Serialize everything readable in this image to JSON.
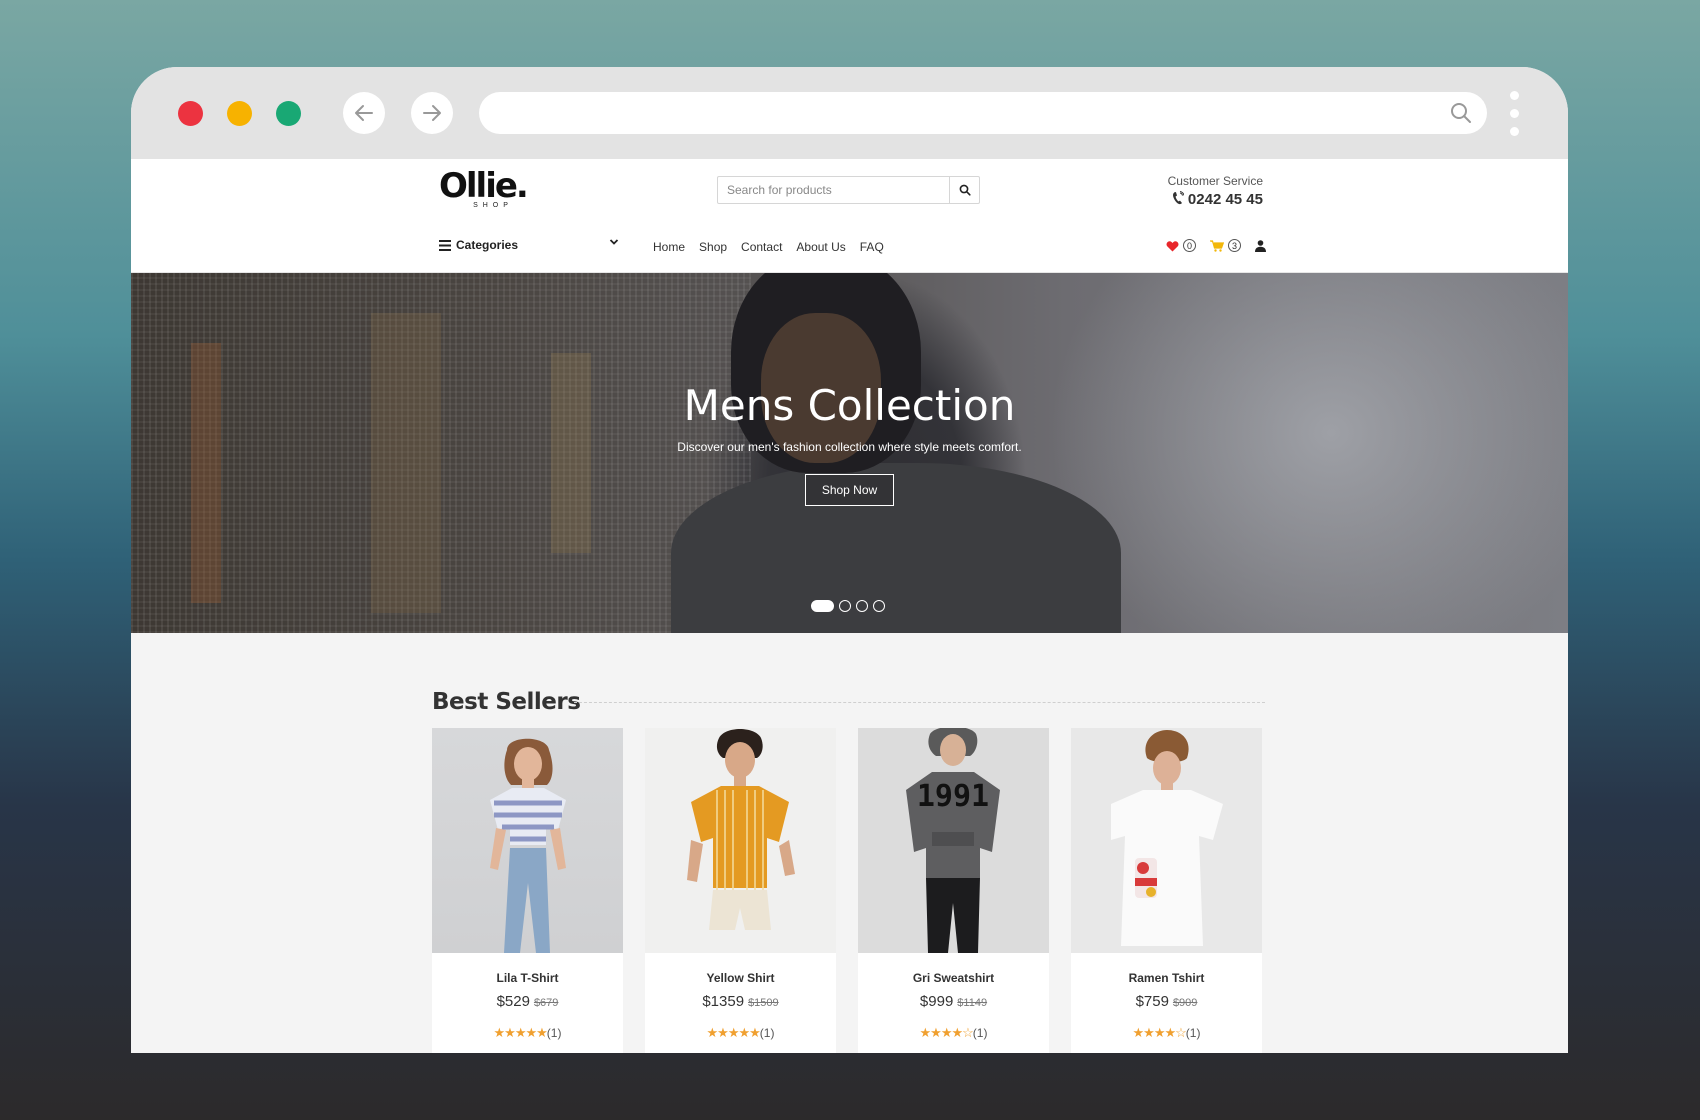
{
  "browser": {
    "colors": {
      "close": "#ec3340",
      "minimize": "#f7b200",
      "maximize": "#19a874"
    },
    "address": ""
  },
  "header": {
    "logo": {
      "main": "Ollie.",
      "sub": "SHOP"
    },
    "search_placeholder": "Search for products",
    "service_label": "Customer Service",
    "service_phone": "0242 45 45",
    "categories_label": "Categories",
    "menu": [
      "Home",
      "Shop",
      "Contact",
      "About Us",
      "FAQ"
    ],
    "wishlist_count": "0",
    "cart_count": "3"
  },
  "hero": {
    "title": "Mens Collection",
    "subtitle": "Discover our men's fashion collection where style meets comfort.",
    "button": "Shop Now",
    "slides": 4,
    "active_slide": 1
  },
  "best_sellers": {
    "title": "Best Sellers",
    "products": [
      {
        "name": "Lila T-Shirt",
        "price": "$529",
        "old_price": "$679",
        "stars": 5,
        "reviews": "(1)"
      },
      {
        "name": "Yellow Shirt",
        "price": "$1359",
        "old_price": "$1509",
        "stars": 5,
        "reviews": "(1)"
      },
      {
        "name": "Gri Sweatshirt",
        "price": "$999",
        "old_price": "$1149",
        "stars": 4,
        "reviews": "(1)"
      },
      {
        "name": "Ramen Tshirt",
        "price": "$759",
        "old_price": "$909",
        "stars": 4,
        "reviews": "(1)"
      }
    ],
    "sweatshirt_print": "1991"
  },
  "colors": {
    "heart": "#e8262b",
    "cart": "#f2b70a",
    "star": "#f0a030"
  }
}
